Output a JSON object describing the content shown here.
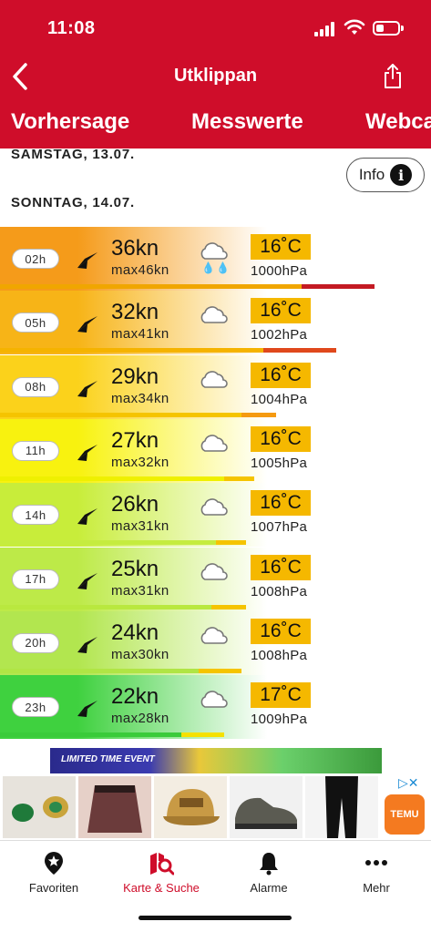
{
  "status": {
    "time": "11:08"
  },
  "nav": {
    "title": "Utklippan"
  },
  "tabs": [
    {
      "label": "Vorhersage"
    },
    {
      "label": "Messwerte"
    },
    {
      "label": "Webca"
    }
  ],
  "days": {
    "prev": "SAMSTAG, 13.07.",
    "current": "SONNTAG, 14.07."
  },
  "info_button": {
    "label": "Info",
    "icon": "i"
  },
  "forecast": [
    {
      "hour": "02h",
      "speed": "36kn",
      "gust": "max46kn",
      "temp": "16˚C",
      "pressure": "1000hPa",
      "rain": "💧💧",
      "bg": "#f59b1a",
      "bar1": "#f0a600",
      "bar2": "#c41a23",
      "speed_frac": 0.7,
      "gust_frac": 0.87
    },
    {
      "hour": "05h",
      "speed": "32kn",
      "gust": "max41kn",
      "temp": "16˚C",
      "pressure": "1002hPa",
      "rain": "",
      "bg": "#f7b417",
      "bar1": "#f5b300",
      "bar2": "#e0481c",
      "speed_frac": 0.61,
      "gust_frac": 0.78
    },
    {
      "hour": "08h",
      "speed": "29kn",
      "gust": "max34kn",
      "temp": "16˚C",
      "pressure": "1004hPa",
      "rain": "",
      "bg": "#fbd21b",
      "bar1": "#f5c400",
      "bar2": "#f59a10",
      "speed_frac": 0.56,
      "gust_frac": 0.64
    },
    {
      "hour": "11h",
      "speed": "27kn",
      "gust": "max32kn",
      "temp": "16˚C",
      "pressure": "1005hPa",
      "rain": "",
      "bg": "#f8f20f",
      "bar1": "#eff000",
      "bar2": "#f5c400",
      "speed_frac": 0.52,
      "gust_frac": 0.59
    },
    {
      "hour": "14h",
      "speed": "26kn",
      "gust": "max31kn",
      "temp": "16˚C",
      "pressure": "1007hPa",
      "rain": "",
      "bg": "#c8ed3a",
      "bar1": "#c5ec3f",
      "bar2": "#f5c400",
      "speed_frac": 0.5,
      "gust_frac": 0.57
    },
    {
      "hour": "17h",
      "speed": "25kn",
      "gust": "max31kn",
      "temp": "16˚C",
      "pressure": "1008hPa",
      "rain": "",
      "bg": "#bdea48",
      "bar1": "#b9e83f",
      "bar2": "#f5c400",
      "speed_frac": 0.49,
      "gust_frac": 0.57
    },
    {
      "hour": "20h",
      "speed": "24kn",
      "gust": "max30kn",
      "temp": "16˚C",
      "pressure": "1008hPa",
      "rain": "",
      "bg": "#b2e64f",
      "bar1": "#b0e545",
      "bar2": "#f5c400",
      "speed_frac": 0.46,
      "gust_frac": 0.56
    },
    {
      "hour": "23h",
      "speed": "22kn",
      "gust": "max28kn",
      "temp": "17˚C",
      "pressure": "1009hPa",
      "rain": "",
      "bg": "#3fd13f",
      "bar1": "#3acb3a",
      "bar2": "#f5e100",
      "speed_frac": 0.42,
      "gust_frac": 0.52
    }
  ],
  "ad": {
    "banner_text": "LIMITED TIME EVENT",
    "choices": "▷✕",
    "brand": "TEMU"
  },
  "bottom_tabs": [
    {
      "label": "Favoriten",
      "icon": "star-pin-icon"
    },
    {
      "label": "Karte & Suche",
      "icon": "map-search-icon",
      "active": true
    },
    {
      "label": "Alarme",
      "icon": "bell-icon"
    },
    {
      "label": "Mehr",
      "icon": "more-dots-icon"
    }
  ]
}
